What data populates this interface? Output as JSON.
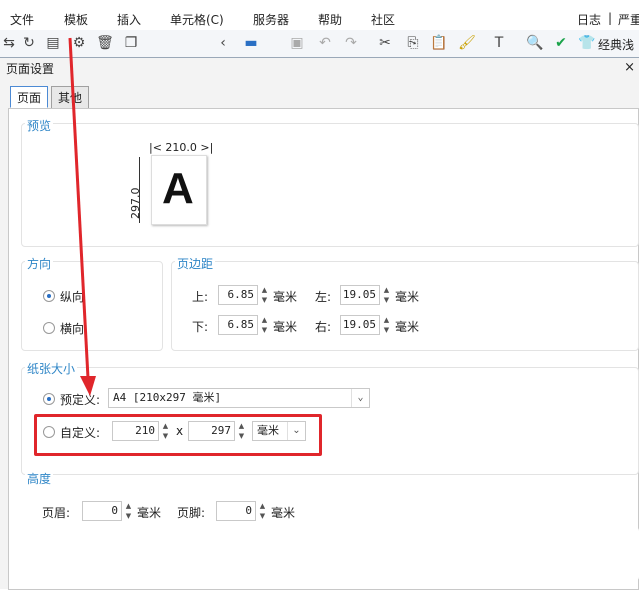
{
  "menubar": {
    "items": [
      "文件",
      "模板",
      "插入",
      "单元格(C)",
      "服务器",
      "帮助",
      "社区"
    ],
    "right_items": [
      "日志",
      "|",
      "严重"
    ]
  },
  "toolbar": {
    "right_label": "经典浅"
  },
  "dialog": {
    "title": "页面设置",
    "close": "×",
    "tabs": [
      "页面",
      "其他"
    ]
  },
  "preview": {
    "group_label": "预览",
    "width_label": "210.0",
    "height_label": "297.0",
    "paper_letter": "A"
  },
  "orientation": {
    "group_label": "方向",
    "portrait": "纵向",
    "landscape": "横向",
    "selected": "portrait"
  },
  "margins": {
    "group_label": "页边距",
    "top_label": "上:",
    "top_value": "6.85",
    "left_label": "左:",
    "left_value": "19.05",
    "bottom_label": "下:",
    "bottom_value": "6.85",
    "right_label": "右:",
    "right_value": "19.05",
    "unit": "毫米"
  },
  "paper": {
    "group_label": "纸张大小",
    "predefined_label": "预定义:",
    "predefined_value": "A4 [210x297 毫米]",
    "custom_label": "自定义:",
    "custom_width": "210",
    "times": "x",
    "custom_height": "297",
    "unit": "毫米",
    "selected": "predefined"
  },
  "height": {
    "group_label": "高度",
    "header_label": "页眉:",
    "header_value": "0",
    "footer_label": "页脚:",
    "footer_value": "0",
    "unit": "毫米"
  },
  "colors": {
    "accent": "#2f86c7",
    "annotation": "#e0262b"
  }
}
